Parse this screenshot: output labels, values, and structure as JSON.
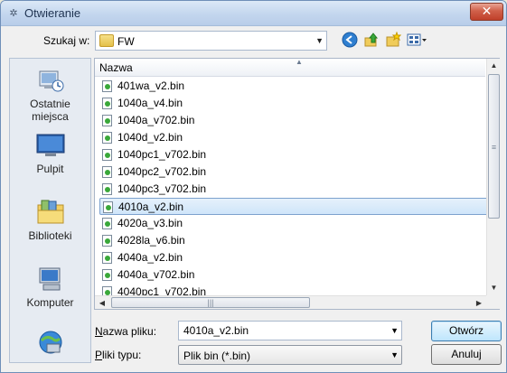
{
  "window": {
    "title": "Otwieranie",
    "close_glyph": "✕"
  },
  "lookin": {
    "label": "Szukaj w:",
    "value": "FW"
  },
  "toolbar": {
    "back_icon": "back-icon",
    "up_icon": "up-folder-icon",
    "new_folder_icon": "new-folder-icon",
    "views_icon": "views-menu-icon"
  },
  "places": [
    {
      "label": "Ostatnie miejsca",
      "icon": "recent-places-icon"
    },
    {
      "label": "Pulpit",
      "icon": "desktop-icon"
    },
    {
      "label": "Biblioteki",
      "icon": "libraries-icon"
    },
    {
      "label": "Komputer",
      "icon": "computer-icon"
    },
    {
      "label": "",
      "icon": "network-icon"
    }
  ],
  "filelist": {
    "column_header": "Nazwa",
    "files": [
      "401wa_v2.bin",
      "1040a_v4.bin",
      "1040a_v702.bin",
      "1040d_v2.bin",
      "1040pc1_v702.bin",
      "1040pc2_v702.bin",
      "1040pc3_v702.bin",
      "4010a_v2.bin",
      "4020a_v3.bin",
      "4028la_v6.bin",
      "4040a_v2.bin",
      "4040a_v702.bin",
      "4040pc1_v702.bin"
    ],
    "selected_index": 7
  },
  "filename": {
    "label": "Nazwa pliku:",
    "value": "4010a_v2.bin"
  },
  "filetype": {
    "label": "Pliki typu:",
    "value": "Plik bin (*.bin)"
  },
  "buttons": {
    "open": "Otwórz",
    "cancel": "Anuluj"
  },
  "colors": {
    "selection": "#cfe5fa",
    "selection_border": "#7da2ce",
    "close_button": "#c0402a"
  }
}
